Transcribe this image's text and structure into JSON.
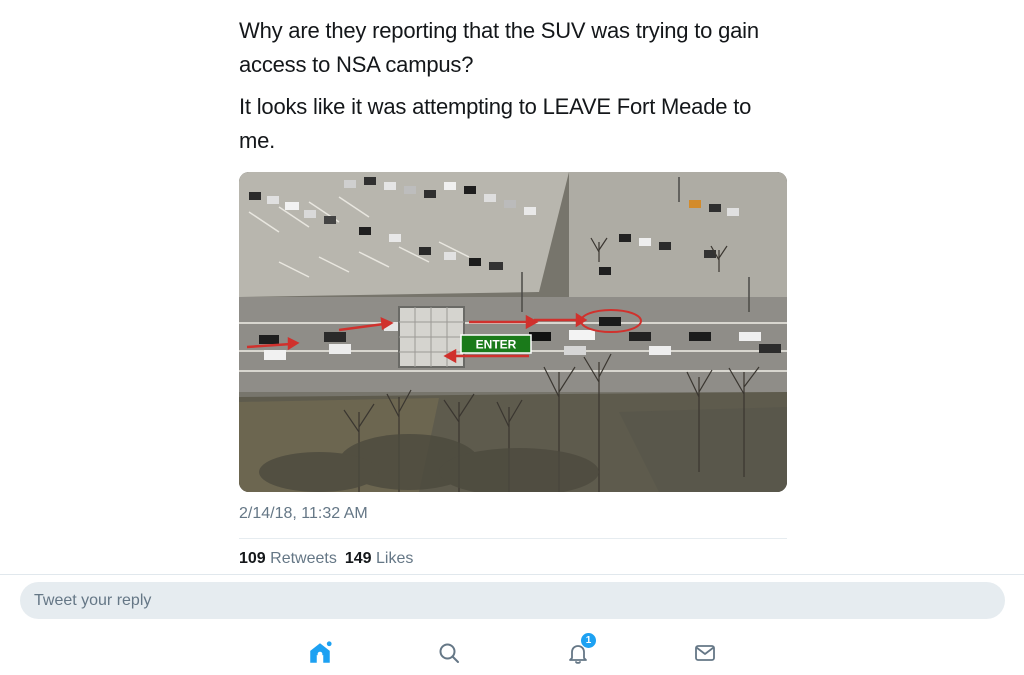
{
  "tweet": {
    "paragraphs": [
      "Why are they reporting that the SUV was trying to gain access to NSA campus?",
      "It looks like it was attempting to LEAVE Fort Meade to me."
    ],
    "media": {
      "overlay_label": "ENTER",
      "overlay_color": "#1a7a1a",
      "arrow_color": "#d0312d"
    },
    "timestamp": "2/14/18, 11:32 AM",
    "stats": {
      "retweets_count": "109",
      "retweets_label": "Retweets",
      "likes_count": "149",
      "likes_label": "Likes"
    }
  },
  "reply": {
    "placeholder": "Tweet your reply"
  },
  "tabbar": {
    "items": [
      {
        "icon": "home-icon",
        "active": true
      },
      {
        "icon": "search-icon",
        "active": false
      },
      {
        "icon": "notifications-icon",
        "active": false,
        "badge": "1"
      },
      {
        "icon": "messages-icon",
        "active": false
      }
    ]
  },
  "colors": {
    "accent": "#1da1f2",
    "text": "#14171a",
    "secondary_text": "#657786",
    "reply_background": "#e6ecf0"
  }
}
